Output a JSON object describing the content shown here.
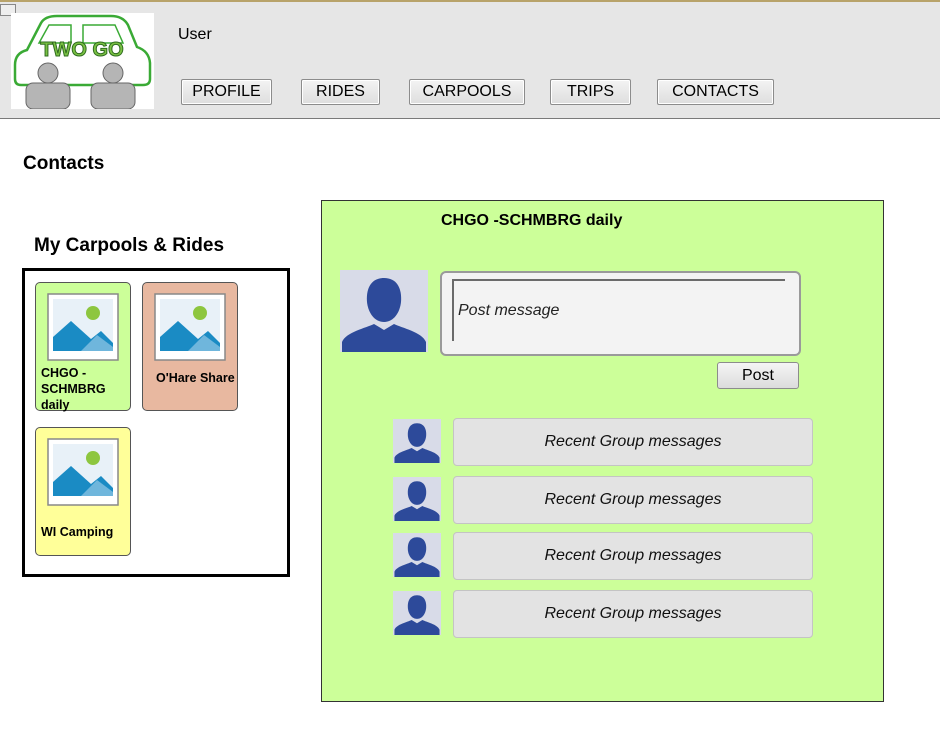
{
  "header": {
    "app_name": "TWO GO",
    "user_label": "User",
    "nav": [
      {
        "label": "PROFILE"
      },
      {
        "label": "RIDES"
      },
      {
        "label": "CARPOOLS"
      },
      {
        "label": "TRIPS"
      },
      {
        "label": "CONTACTS"
      }
    ]
  },
  "page": {
    "title": "Contacts"
  },
  "carpools": {
    "title": "My Carpools & Rides",
    "items": [
      {
        "label": "CHGO - SCHMBRG daily",
        "color": "#ccff99"
      },
      {
        "label": "O'Hare Share",
        "color": "#e8b8a0"
      },
      {
        "label": "WI Camping",
        "color": "#ffff99"
      }
    ]
  },
  "group": {
    "title": "CHGO -SCHMBRG daily",
    "post_placeholder": "Post message",
    "post_button": "Post",
    "messages": [
      {
        "text": "Recent Group messages"
      },
      {
        "text": "Recent Group messages"
      },
      {
        "text": "Recent Group messages"
      },
      {
        "text": "Recent Group messages"
      }
    ],
    "panel_color": "#ccff99"
  },
  "icons": [
    "car-logo",
    "image-placeholder-icon",
    "person-avatar-icon"
  ]
}
